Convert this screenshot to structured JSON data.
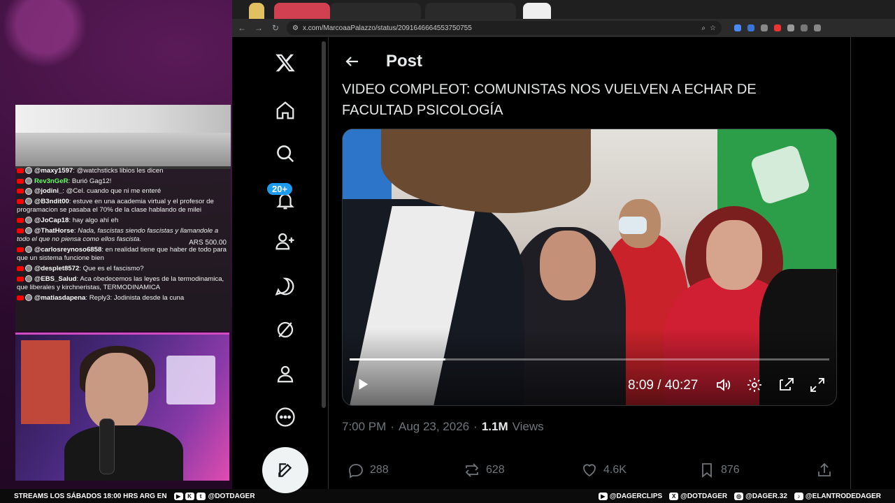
{
  "browser": {
    "url": "x.com/MarcoaaPalazzo/status/2091646664553750755"
  },
  "chat": [
    {
      "user": "@maxy1597",
      "text": "@watchsticks libios les dicen",
      "style": "normal"
    },
    {
      "user": "Rev3nGeR",
      "text": "Burió Gag12!",
      "style": "green"
    },
    {
      "user": "@jodini_",
      "text": "@Cel. cuando que ni me enteré",
      "style": "normal"
    },
    {
      "user": "@B3ndit00",
      "text": "estuve en una academia virtual y el profesor de programacion se pasaba el 70% de la clase hablando de milei",
      "style": "normal"
    },
    {
      "user": "@JoCap18",
      "text": "hay algo ahí eh",
      "style": "normal"
    },
    {
      "user": "@ThatHorse",
      "text": "Nada, fascistas siendo fascistas y llamandole a todo el que no piensa como ellos fascista.",
      "style": "italic",
      "donation": "ARS 500.00"
    },
    {
      "user": "@carlosreynoso6858",
      "text": "en realidad tiene que haber de todo para que un sistema funcione bien",
      "style": "normal"
    },
    {
      "user": "@desplet8572",
      "text": "Que es el fascismo?",
      "style": "normal"
    },
    {
      "user": "@EBS_Salud",
      "text": "Aca obedecemos las leyes de la termodinamica, que liberales y kirchneristas, TERMODINAMICA",
      "style": "normal"
    },
    {
      "user": "@matiasdapena",
      "text": "Reply3: Jodinista desde la cuna",
      "style": "normal"
    }
  ],
  "bottom_bar": {
    "left_text": "STREAMS LOS SÁBADOS 18:00 HRS ARG EN",
    "left_handle": "@DOTDAGER",
    "right_items": [
      "@DAGERCLIPS",
      "@DOTDAGER",
      "@DAGER.32",
      "@ELANTRODEDAGER"
    ]
  },
  "x_nav": {
    "notification_badge": "20+",
    "icons": [
      "x-logo-icon",
      "home-icon",
      "search-icon",
      "bell-icon",
      "people-icon",
      "grok-icon",
      "premium-icon",
      "profile-icon",
      "more-icon",
      "compose-icon"
    ]
  },
  "post": {
    "header_title": "Post",
    "text_line1": "VIDEO COMPLEOT: COMUNISTAS NOS VUELVEN A ECHAR DE",
    "text_line2": "FACULTAD PSICOLOGÍA",
    "video": {
      "current_time": "8:09",
      "duration": "40:27",
      "time_display": "8:09 / 40:27",
      "progress_fraction": 0.2
    },
    "time": "7:00 PM",
    "date": "Aug 23, 2026",
    "views_count": "1.1M",
    "views_label": "Views",
    "replies": "288",
    "reposts": "628",
    "likes": "4.6K",
    "bookmarks": "876"
  },
  "colors": {
    "accent": "#1d9bf0",
    "bg": "#000000",
    "text": "#e7e9ea",
    "muted": "#71767b"
  }
}
